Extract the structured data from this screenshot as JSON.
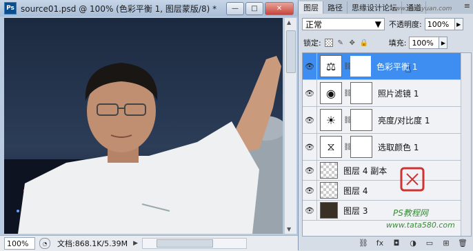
{
  "document": {
    "title": "source01.psd @ 100% (色彩平衡 1, 图层蒙版/8) *",
    "ps_logo": "Ps",
    "window_buttons": [
      "minimize-icon",
      "maximize-icon",
      "close-icon"
    ],
    "status": {
      "zoom": "100%",
      "doc_info": "文档:868.1K/5.39M"
    }
  },
  "panel": {
    "tabs": [
      "图层",
      "路径",
      "思缘设计论坛",
      "通道"
    ],
    "blend_mode": "正常",
    "opacity_label": "不透明度:",
    "opacity_value": "100%",
    "lock_label": "锁定:",
    "fill_label": "填充:",
    "fill_value": "100%",
    "layers": [
      {
        "name": "色彩平衡 1",
        "icon": "balance-icon",
        "selected": true,
        "mask": true
      },
      {
        "name": "照片滤镜 1",
        "icon": "photo-filter-icon",
        "selected": false,
        "mask": true
      },
      {
        "name": "亮度/对比度 1",
        "icon": "brightness-icon",
        "selected": false,
        "mask": true
      },
      {
        "name": "选取颜色 1",
        "icon": "selective-color-icon",
        "selected": false,
        "mask": true
      },
      {
        "name": "图层 4 副本",
        "icon": "transparent-thumbnail",
        "selected": false,
        "mask": false
      },
      {
        "name": "图层 4",
        "icon": "transparent-thumbnail",
        "selected": false,
        "mask": false
      },
      {
        "name": "图层 3",
        "icon": "photo-thumbnail",
        "selected": false,
        "mask": false
      }
    ],
    "bottom_icons": [
      "link-icon",
      "fx-icon",
      "mask-icon",
      "adjustment-icon",
      "folder-icon",
      "new-layer-icon",
      "trash-icon"
    ]
  },
  "watermark": {
    "site_cn": "PS教程网",
    "site_url": "www.tata580.com",
    "forum": "www.missyuan.com"
  }
}
